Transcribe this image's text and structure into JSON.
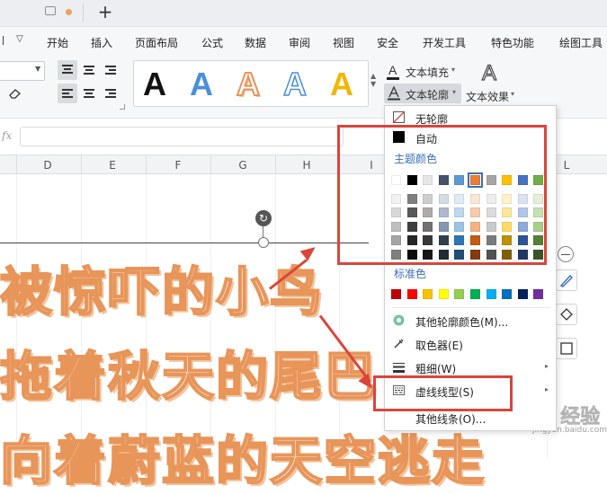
{
  "tabs": {
    "new_tab": "+"
  },
  "menu": {
    "items": [
      "开始",
      "插入",
      "页面布局",
      "公式",
      "数据",
      "审阅",
      "视图",
      "安全",
      "开发工具",
      "特色功能",
      "绘图工具"
    ]
  },
  "ribbon": {
    "style_gallery_glyph": "A",
    "style_colors": [
      "#111111",
      "#4a90d9",
      "#e8955a",
      "#4a90d9",
      "#f2b705"
    ],
    "text_fill": "文本填充",
    "text_outline": "文本轮廓",
    "text_effect": "文本效果",
    "text_effect_glyph": "A"
  },
  "formula": {
    "fx": "fx"
  },
  "columns": [
    "D",
    "E",
    "F",
    "G",
    "H",
    "I",
    "L"
  ],
  "sheet": {
    "art_lines": [
      "被惊吓的小鸟",
      "拖着秋天的尾巴",
      "向着蔚蓝的天空逃走"
    ],
    "colors": {
      "outline": "#e8955a",
      "shadow": "#f4c49c"
    }
  },
  "dropdown": {
    "no_outline": "无轮廓",
    "auto": "自动",
    "theme_colors_title": "主题颜色",
    "theme_colors": [
      [
        "#ffffff",
        "#000000",
        "#e7e6e6",
        "#44546a",
        "#5b9bd5",
        "#ed7d31",
        "#a5a5a5",
        "#ffc000",
        "#4472c4",
        "#70ad47"
      ],
      [
        "#f2f2f2",
        "#7f7f7f",
        "#d0cece",
        "#d6dce4",
        "#deebf6",
        "#fbe5d5",
        "#ededed",
        "#fff2cc",
        "#dae3f3",
        "#e2efd9"
      ],
      [
        "#d8d8d8",
        "#595959",
        "#aeaaaa",
        "#adb9ca",
        "#bdd7ee",
        "#f8cbad",
        "#dbdbdb",
        "#fee599",
        "#b4c6e7",
        "#c5e0b3"
      ],
      [
        "#bfbfbf",
        "#3f3f3f",
        "#757070",
        "#8496b0",
        "#9dc3e6",
        "#f4b183",
        "#c9c9c9",
        "#ffd965",
        "#8eaadb",
        "#a8d08d"
      ],
      [
        "#a5a5a5",
        "#262626",
        "#3a3838",
        "#323f4f",
        "#2e75b5",
        "#c55a11",
        "#7b7b7b",
        "#bf9000",
        "#2f5496",
        "#538135"
      ],
      [
        "#7f7f7f",
        "#0c0c0c",
        "#171616",
        "#222a35",
        "#1f4e79",
        "#833c0b",
        "#525252",
        "#7f6000",
        "#1f3864",
        "#375623"
      ]
    ],
    "selected_theme_color": "#ed7d31",
    "standard_colors_title": "标准色",
    "standard_colors": [
      "#c00000",
      "#ff0000",
      "#ffc000",
      "#ffff00",
      "#92d050",
      "#00b050",
      "#00b0f0",
      "#0070c0",
      "#002060",
      "#7030a0"
    ],
    "more_colors": "其他轮廓颜色(M)...",
    "eyedropper": "取色器(E)",
    "weight": "粗细(W)",
    "dash_type": "虚线线型(S)",
    "other_lines": "其他线条(O)..."
  },
  "annotation_color": "#d9453b",
  "watermark": {
    "text": "Baidu 经验",
    "sub": "jingyan.baidu.com"
  }
}
